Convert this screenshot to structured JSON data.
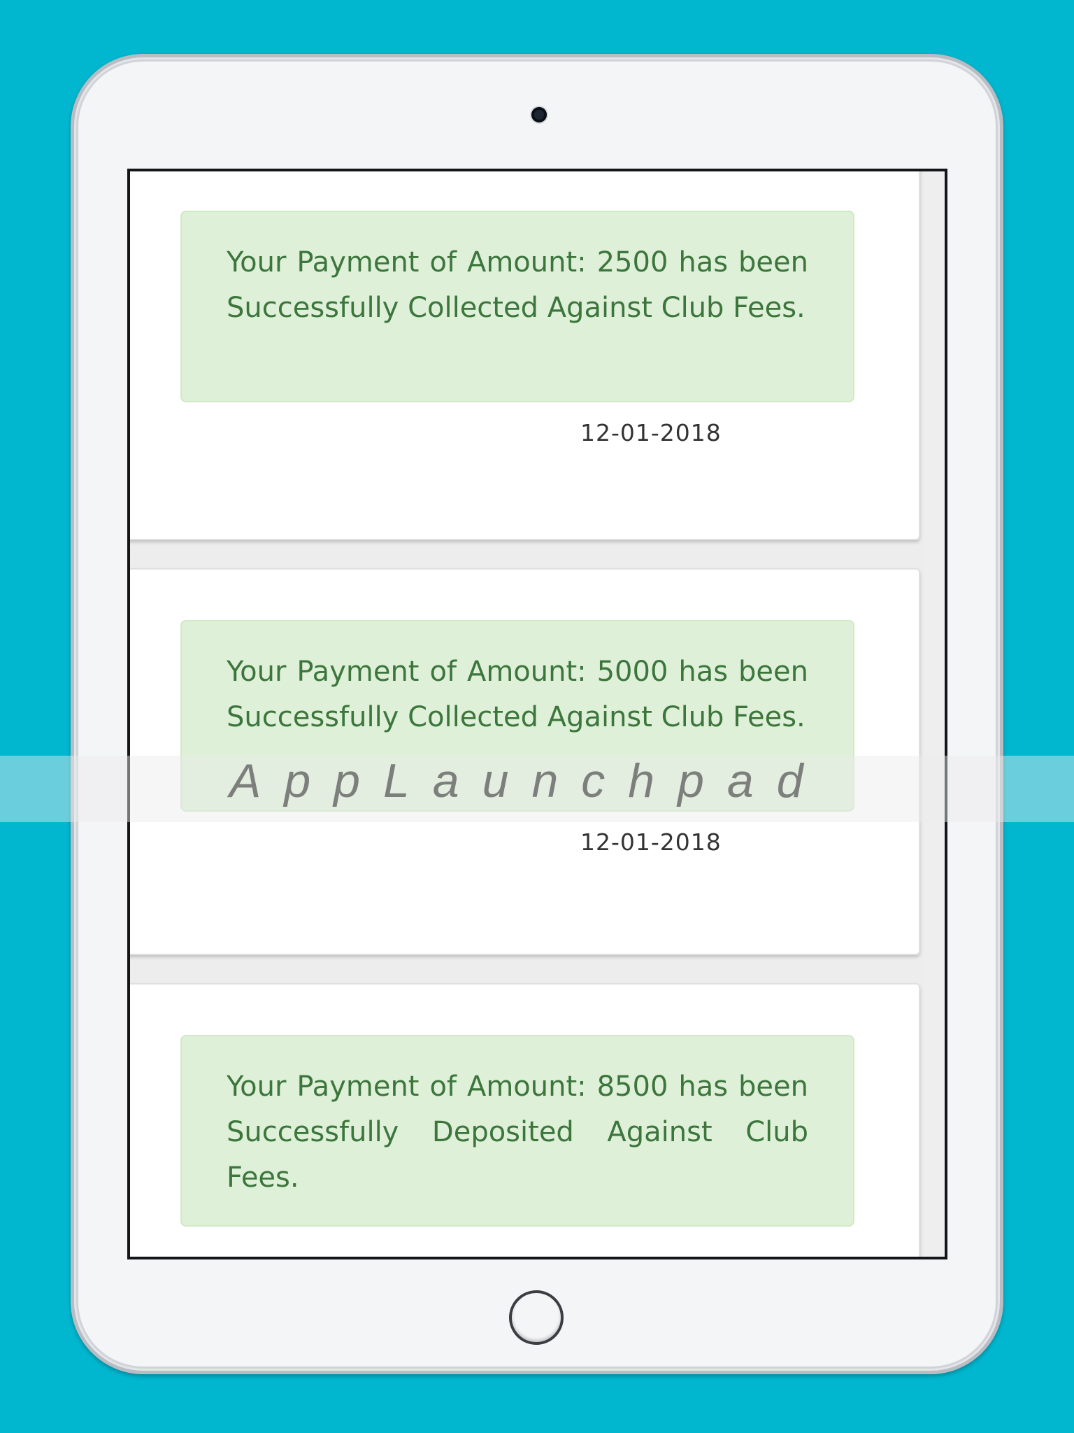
{
  "notifications": [
    {
      "message": "Your Payment of Amount: 2500 has been Successfully Collected Against Club Fees.",
      "date": "12-01-2018"
    },
    {
      "message": "Your Payment of Amount: 5000 has been Successfully Collected Against Club Fees.",
      "date": "12-01-2018"
    },
    {
      "message": "Your Payment of Amount: 8500 has been Successfully Deposited Against Club Fees.",
      "date": ""
    }
  ],
  "watermark": {
    "text": "AppLaunchpad"
  },
  "colors": {
    "background": "#00b7cf",
    "alert_background": "#dff0d8",
    "alert_text": "#3c763d"
  },
  "icons": {
    "camera": "camera-icon",
    "home_button": "home-button-icon"
  }
}
